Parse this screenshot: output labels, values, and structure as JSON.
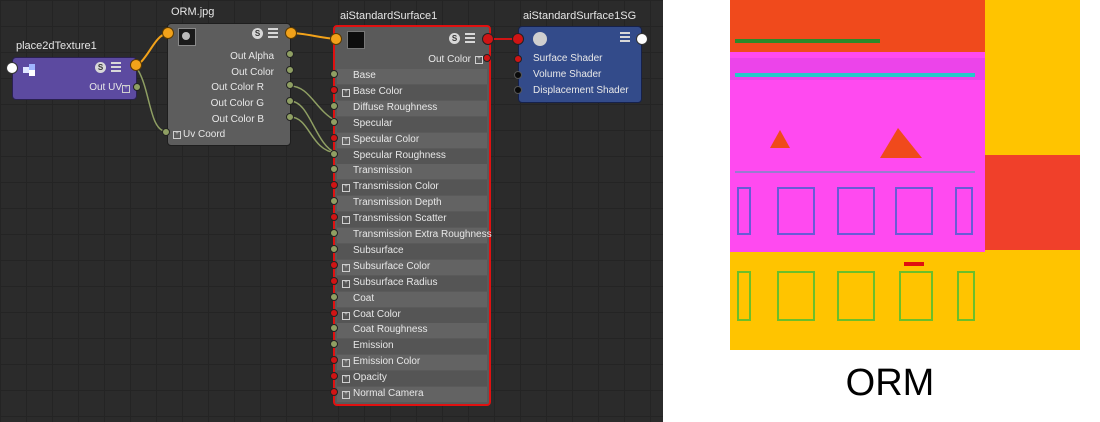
{
  "editor": {
    "place2d": {
      "title": "place2dTexture1",
      "out_uv": "Out UV"
    },
    "file": {
      "title": "ORM.jpg",
      "attrs": [
        "Out Alpha",
        "Out Color",
        "Out Color R",
        "Out Color G",
        "Out Color B"
      ],
      "uv_coord": "Uv Coord"
    },
    "surface": {
      "title": "aiStandardSurface1",
      "out_color": "Out Color",
      "attrs": [
        "Base",
        "Base Color",
        "Diffuse Roughness",
        "Specular",
        "Specular Color",
        "Specular Roughness",
        "Transmission",
        "Transmission Color",
        "Transmission Depth",
        "Transmission Scatter",
        "Transmission Extra Roughness",
        "Subsurface",
        "Subsurface Color",
        "Subsurface Radius",
        "Coat",
        "Coat Color",
        "Coat Roughness",
        "Emission",
        "Emission Color",
        "Opacity",
        "Normal Camera"
      ],
      "compound": [
        false,
        true,
        false,
        false,
        true,
        false,
        false,
        true,
        false,
        true,
        false,
        false,
        true,
        true,
        false,
        true,
        false,
        false,
        true,
        true,
        true
      ]
    },
    "sg": {
      "title": "aiStandardSurface1SG",
      "attrs": [
        "Surface Shader",
        "Volume Shader",
        "Displacement Shader"
      ]
    },
    "badge": "S"
  },
  "preview": {
    "caption": "ORM"
  },
  "colors": {
    "place2d_node": "#5c4aa0",
    "sg_node": "#334b8a",
    "selection": "#e01010",
    "connector_orange": "#f2a21a",
    "preview_magenta": "#ff4af0",
    "preview_yellow": "#ffc400",
    "preview_red": "#f0402a"
  },
  "icons": [
    "place2d-texture-icon",
    "texture-thumbnail-icon",
    "shader-swatch-icon",
    "shading-group-icon",
    "menu-icon",
    "badge-icon"
  ]
}
